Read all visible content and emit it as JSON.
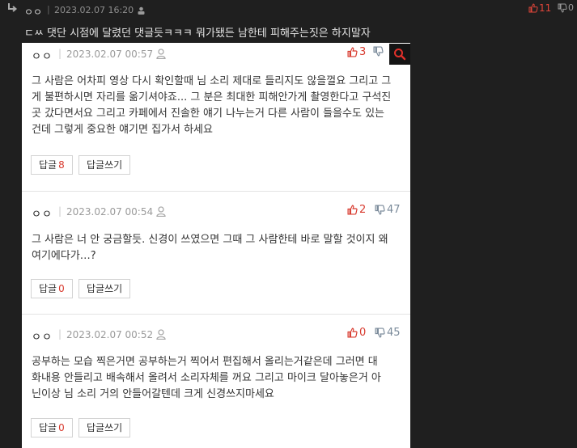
{
  "top": {
    "nickname": "ㅇㅇ",
    "separator": "|",
    "date": "2023.02.07 16:20",
    "upvotes": "11",
    "downvotes": "0",
    "text": "ㄷㅆ 댓단 시점에 달렸던 댓글듯ㅋㅋㅋ 뭐가됐든 남한테 피해주는짓은 하지말자"
  },
  "comments": [
    {
      "nickname": "ㅇㅇ",
      "separator": "|",
      "date": "2023.02.07 00:57",
      "upvotes": "3",
      "downvotes": "",
      "lines": [
        "그 사람은 어차피 영상 다시 확인할때 님 소리 제대로 들리지도 않을껄요 그리고 그",
        "게 불편하시면 자리를 옮기셔야죠... 그 분은 최대한 피해안가게 촬영한다고 구석진",
        "곳 갔다면서요 그리고 카페에서 진솔한 얘기 나누는거 다른 사람이 들을수도 있는",
        "건데 그렇게 중요한 얘기면 집가서 하세요"
      ],
      "reply_label": "답글",
      "reply_count": "8",
      "write_label": "답글쓰기"
    },
    {
      "nickname": "ㅇㅇ",
      "separator": "|",
      "date": "2023.02.07 00:54",
      "upvotes": "2",
      "downvotes": "47",
      "lines": [
        "그 사람은 너 안 궁금할듯. 신경이 쓰였으면 그때 그 사람한테 바로 말할 것이지 왜",
        "여기에다가…?"
      ],
      "reply_label": "답글",
      "reply_count": "0",
      "write_label": "답글쓰기"
    },
    {
      "nickname": "ㅇㅇ",
      "separator": "|",
      "date": "2023.02.07 00:52",
      "upvotes": "0",
      "downvotes": "45",
      "lines": [
        "공부하는 모습 찍은거면 공부하는거 찍어서 편집해서 올리는거같은데 그러면 대",
        "화내용 안들리고 배속해서 올려서 소리자체를 꺼요 그리고 마이크 달아놓은거 아",
        "닌이상 님 소리 거의 안들어갈텐데 크게 신경쓰지마세요"
      ],
      "reply_label": "답글",
      "reply_count": "0",
      "write_label": "답글쓰기"
    }
  ],
  "colors": {
    "background": "#1f1f1f",
    "panel": "#ffffff",
    "upvote": "#d83a2e",
    "downvote": "#7a8a9a"
  },
  "icons": [
    "reply-arrow-icon",
    "user-icon",
    "thumbs-up-icon",
    "thumbs-down-icon",
    "search-icon"
  ]
}
